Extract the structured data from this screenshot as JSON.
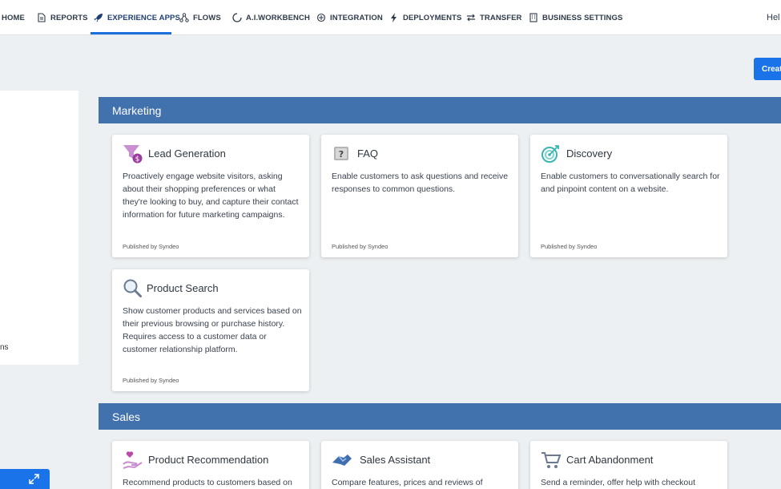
{
  "nav": {
    "items": [
      {
        "label": "HOME",
        "icon": "home-icon"
      },
      {
        "label": "REPORTS",
        "icon": "document-icon"
      },
      {
        "label": "EXPERIENCE APPS",
        "icon": "rocket-icon"
      },
      {
        "label": "FLOWS",
        "icon": "flow-icon"
      },
      {
        "label": "A.I.WORKBENCH",
        "icon": "circle-icon"
      },
      {
        "label": "INTEGRATION",
        "icon": "integration-icon"
      },
      {
        "label": "DEPLOYMENTS",
        "icon": "bolt-icon"
      },
      {
        "label": "TRANSFER",
        "icon": "transfer-icon"
      },
      {
        "label": "BUSINESS SETTINGS",
        "icon": "building-icon"
      }
    ],
    "active": "EXPERIENCE APPS",
    "greeting": "Hel"
  },
  "create_button": {
    "label": "Creat"
  },
  "left_panel": {
    "partial_text": "ns"
  },
  "sections": [
    {
      "title": "Marketing",
      "cards": [
        {
          "title": "Lead Generation",
          "icon": "funnel-dollar-icon",
          "description": "Proactively engage website visitors, asking about their shopping preferences or what they're looking to buy, and capture their contact information for future marketing campaigns.",
          "publisher": "Published by Syndeo"
        },
        {
          "title": "FAQ",
          "icon": "question-box-icon",
          "description": "Enable customers to ask questions and receive responses to common questions.",
          "publisher": "Published by Syndeo"
        },
        {
          "title": "Discovery",
          "icon": "target-icon",
          "description": "Enable customers to conversationally search for and pinpoint content on a website.",
          "publisher": "Published by Syndeo"
        },
        {
          "title": "Product Search",
          "icon": "magnifier-icon",
          "description": "Show customer products and services based on their previous browsing or purchase history. Requires access to a customer data or customer relationship platform.",
          "publisher": "Published by Syndeo"
        }
      ]
    },
    {
      "title": "Sales",
      "cards": [
        {
          "title": "Product Recommendation",
          "icon": "hand-heart-icon",
          "description": "Recommend products to customers based on"
        },
        {
          "title": "Sales Assistant",
          "icon": "handshake-icon",
          "description": "Compare features, prices and reviews of"
        },
        {
          "title": "Cart Abandonment",
          "icon": "cart-icon",
          "description": "Send a reminder, offer help with checkout"
        }
      ]
    }
  ],
  "colors": {
    "accent": "#1a73e8",
    "section_bar": "#4272ad",
    "background": "#edf0f3"
  }
}
